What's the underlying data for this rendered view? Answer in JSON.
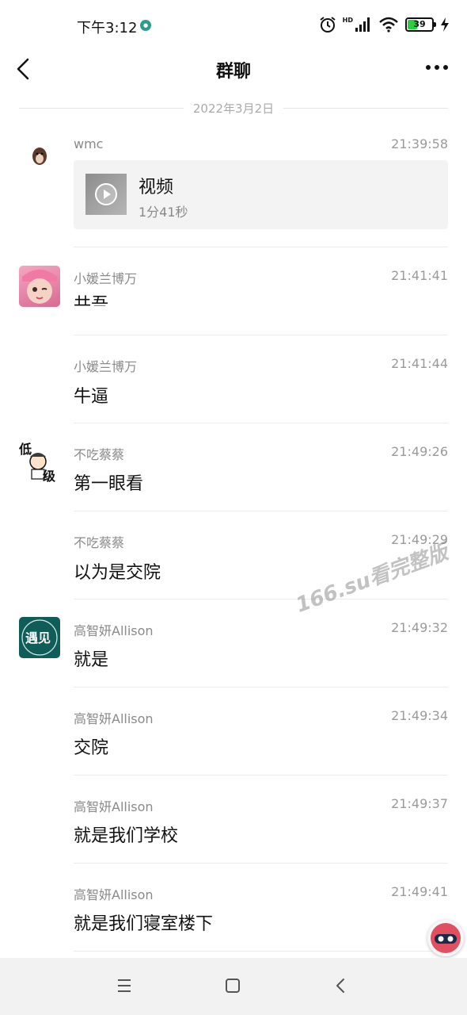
{
  "status_bar": {
    "time": "下午3:12",
    "network_label": "HD",
    "battery": "39",
    "battery_level": 0.39
  },
  "header": {
    "title": "群聊"
  },
  "date_divider": "2022年3月2日",
  "messages": [
    {
      "sender": "wmc",
      "time": "21:39:58",
      "type": "video",
      "video": {
        "title": "视频",
        "duration": "1分41秒"
      }
    },
    {
      "sender": "小媛兰博万",
      "time": "21:41:41",
      "text": "共吾..."
    },
    {
      "sender": "小媛兰博万",
      "time": "21:41:44",
      "text": "牛逼"
    },
    {
      "sender": "不吃蔡蔡",
      "time": "21:49:26",
      "text": "第一眼看"
    },
    {
      "sender": "不吃蔡蔡",
      "time": "21:49:29",
      "text": "以为是交院"
    },
    {
      "sender": "高智妍Allison",
      "time": "21:49:32",
      "text": "就是"
    },
    {
      "sender": "高智妍Allison",
      "time": "21:49:34",
      "text": "交院"
    },
    {
      "sender": "高智妍Allison",
      "time": "21:49:37",
      "text": "就是我们学校"
    },
    {
      "sender": "高智妍Allison",
      "time": "21:49:41",
      "text": "就是我们寝室楼下"
    }
  ],
  "avatars": {
    "a4_top": "低",
    "a4_bottom": "级",
    "a6_text": "遇见"
  },
  "watermark": "166.su看完整版",
  "icons": [
    "back-icon",
    "more-icon",
    "alarm-icon",
    "signal-icon",
    "wifi-icon",
    "battery-icon",
    "charging-icon",
    "play-icon",
    "menu-icon",
    "home-icon",
    "nav-back-icon"
  ]
}
